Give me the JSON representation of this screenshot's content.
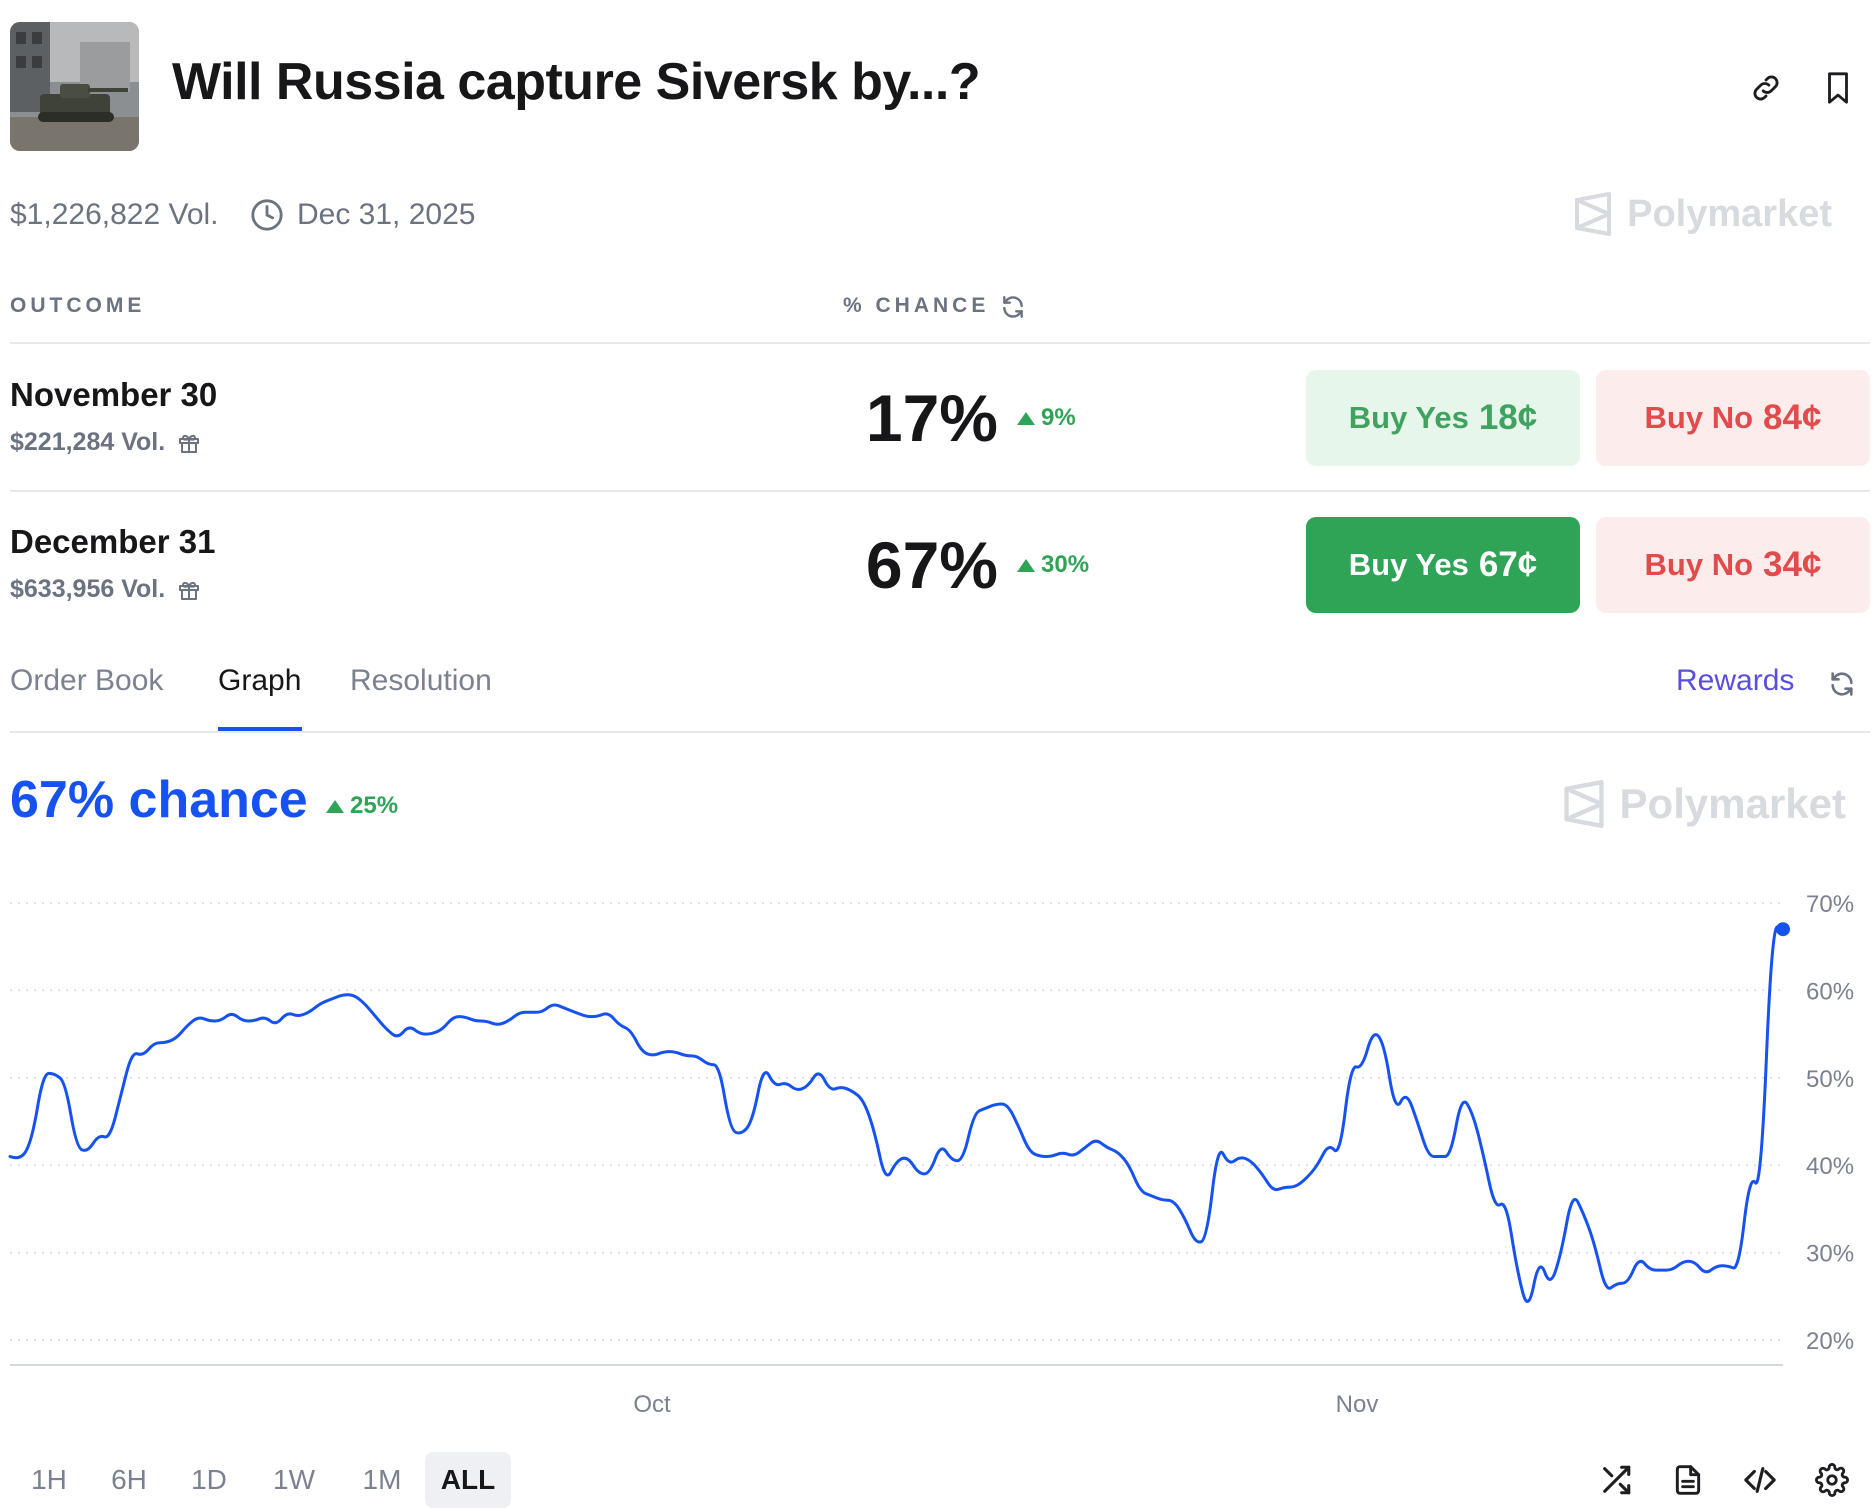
{
  "header": {
    "title": "Will Russia capture Siversk by...?",
    "volume": "$1,226,822 Vol.",
    "end_date": "Dec 31, 2025",
    "brand": "Polymarket",
    "icons": [
      "link-icon",
      "bookmark-icon",
      "clock-icon",
      "polymarket-logo-icon"
    ]
  },
  "table": {
    "col_outcome": "OUTCOME",
    "col_chance": "% CHANCE",
    "rows": [
      {
        "name": "November 30",
        "volume": "$221,284 Vol.",
        "chance": "17%",
        "delta": "9%",
        "buy_yes_label": "Buy Yes",
        "buy_yes_price": "18¢",
        "buy_no_label": "Buy No",
        "buy_no_price": "84¢"
      },
      {
        "name": "December 31",
        "volume": "$633,956 Vol.",
        "chance": "67%",
        "delta": "30%",
        "buy_yes_label": "Buy Yes",
        "buy_yes_price": "67¢",
        "buy_no_label": "Buy No",
        "buy_no_price": "34¢"
      }
    ]
  },
  "tabs": {
    "items": [
      "Order Book",
      "Graph",
      "Resolution"
    ],
    "active": "Graph",
    "rewards": "Rewards"
  },
  "graph": {
    "chance": "67% chance",
    "delta": "25%",
    "brand": "Polymarket"
  },
  "colors": {
    "accent_blue": "#1652f0",
    "up_green": "#2fa356",
    "no_red": "#e24b4b"
  },
  "time_range": {
    "options": [
      "1H",
      "6H",
      "1D",
      "1W",
      "1M",
      "ALL"
    ],
    "selected": "ALL"
  },
  "toolbar_icons": [
    "shuffle-icon",
    "document-icon",
    "code-icon",
    "settings-icon"
  ],
  "chart_data": {
    "type": "line",
    "series": [
      {
        "values": [
          41,
          40.5,
          43,
          50.5,
          50.5,
          49.5,
          42,
          41.5,
          43.5,
          43,
          48,
          53,
          52.5,
          54,
          54,
          54.5,
          56,
          57,
          56.5,
          56.5,
          57.5,
          56.5,
          56.5,
          57,
          56,
          57.5,
          57,
          57.5,
          58.5,
          59,
          59.5,
          59.5,
          58.5,
          57,
          55.5,
          54.5,
          56,
          55,
          55,
          55.5,
          57,
          57,
          56.5,
          56.5,
          56,
          56.5,
          57.5,
          57.5,
          57.5,
          58.5,
          58,
          57.5,
          57,
          57,
          57.5,
          56,
          55.5,
          53,
          52.5,
          53,
          53,
          52.5,
          52.5,
          51.5,
          51.5,
          44,
          43.5,
          45,
          51.5,
          49,
          49.5,
          48.5,
          49,
          51,
          48.5,
          49,
          48.5,
          47.5,
          44,
          38,
          40.5,
          41,
          39,
          39,
          42.5,
          40.5,
          40.5,
          46,
          46.5,
          47,
          47,
          44.5,
          41.5,
          41,
          41,
          41.5,
          41,
          42,
          43,
          42,
          41.5,
          40,
          37,
          36.5,
          36,
          36,
          34,
          31,
          31.5,
          42.5,
          40,
          41,
          40.5,
          39,
          37,
          37.5,
          37.5,
          38.5,
          40,
          42.5,
          41,
          51.5,
          51,
          55.5,
          54,
          46,
          48.5,
          45,
          41,
          41,
          41,
          48,
          46,
          41,
          35,
          36,
          28,
          23,
          29.5,
          26,
          30,
          37,
          34.5,
          31,
          25.5,
          26.5,
          26.5,
          29.5,
          28,
          28,
          28,
          29,
          29,
          27.5,
          28.5,
          28.5,
          28,
          39,
          37,
          67.5,
          67
        ]
      }
    ],
    "x_tick_labels": [
      "Oct",
      "Nov"
    ],
    "y_tick_labels": [
      "70%",
      "60%",
      "50%",
      "40%",
      "30%",
      "20%"
    ],
    "ylim": [
      20,
      70
    ],
    "grid": true,
    "color": "#1652f0",
    "last_value": 67
  }
}
